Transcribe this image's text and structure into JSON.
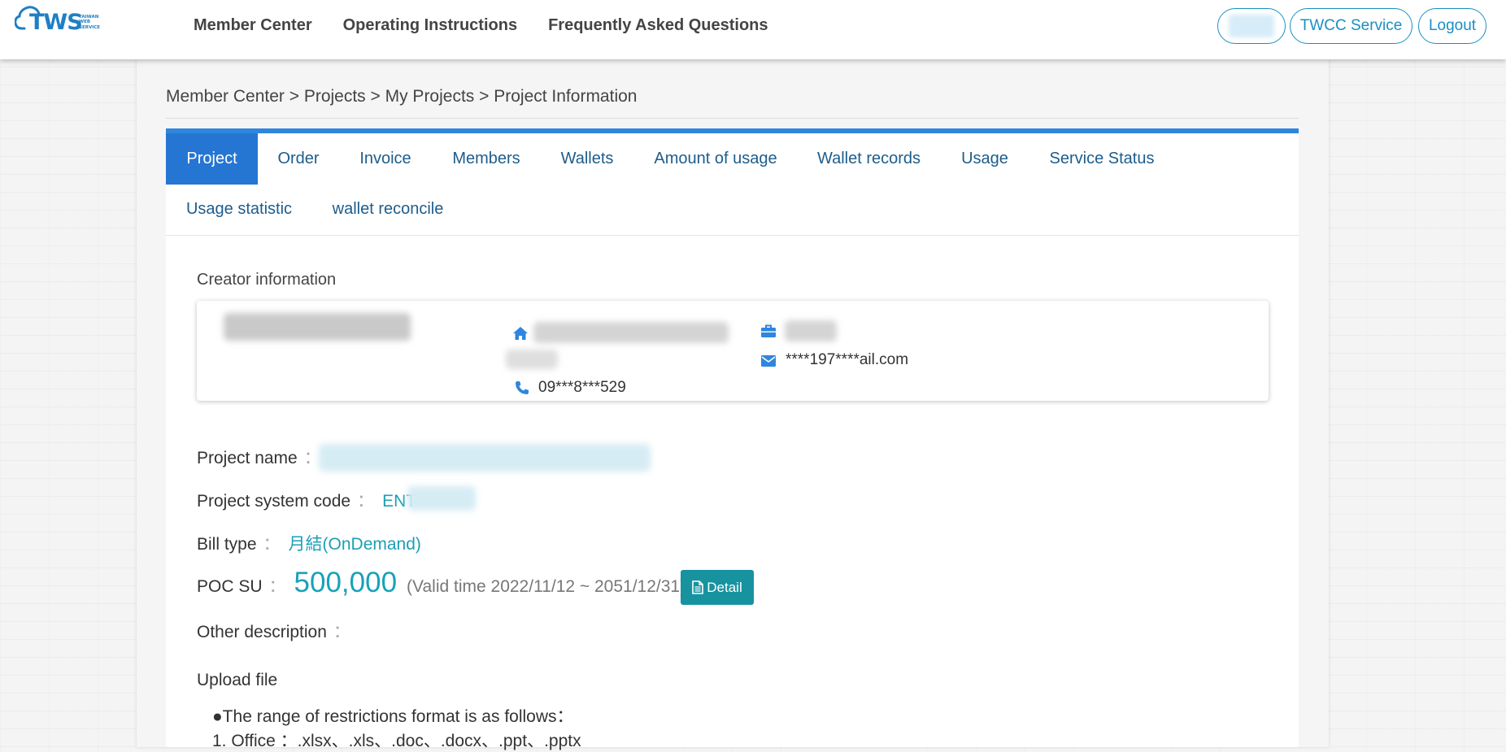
{
  "header": {
    "logo": {
      "text": "TWS",
      "subtitle": [
        "TAIWAN",
        "WEB",
        "SERVICE"
      ]
    },
    "nav": [
      "Member Center",
      "Operating Instructions",
      "Frequently Asked Questions"
    ],
    "buttons": {
      "user": "",
      "twcc": "TWCC Service",
      "logout": "Logout"
    }
  },
  "breadcrumb": "Member Center > Projects > My Projects > Project Information",
  "tabs": {
    "project": "Project",
    "order": "Order",
    "invoice": "Invoice",
    "members": "Members",
    "wallets": "Wallets",
    "amount_of_usage": "Amount of usage",
    "wallet_records": "Wallet records",
    "usage": "Usage",
    "service_status": "Service Status",
    "usage_statistic": "Usage statistic",
    "wallet_reconcile": "wallet reconcile"
  },
  "creator": {
    "section_title": "Creator information",
    "phone": "09***8***529",
    "email": "****197****ail.com"
  },
  "project": {
    "name_label": "Project name",
    "system_code_label": "Project system code",
    "system_code_prefix": "ENT",
    "bill_type_label": "Bill type",
    "bill_type_value": "月結(OnDemand)",
    "poc_su_label": "POC SU",
    "poc_su_value": "500,000",
    "valid_time": "(Valid time 2022/11/12 ~ 2051/12/31)",
    "detail_button": "Detail",
    "other_description_label": "Other description",
    "colon": "："
  },
  "upload": {
    "title": "Upload file",
    "restriction": "●The range of restrictions format is as follows：",
    "office": "1. Office ：.xlsx、.xls、.doc、.docx、.ppt、.pptx"
  },
  "colors": {
    "brand": "#1f7fc4",
    "tab_active": "#2576d2",
    "accent_teal": "#17a2b8",
    "detail_button": "#17939f"
  }
}
